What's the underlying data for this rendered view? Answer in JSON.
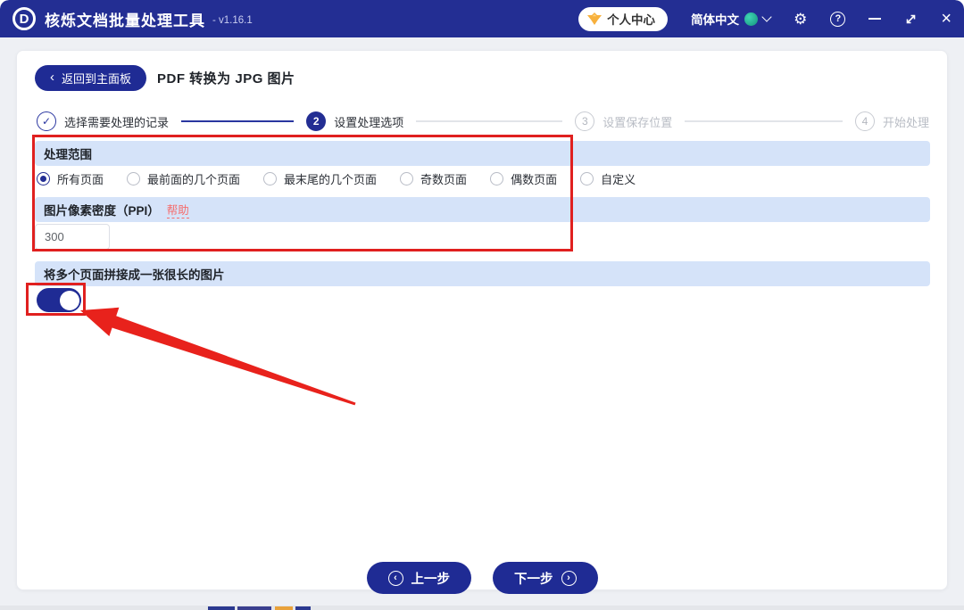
{
  "titlebar": {
    "logo_letter": "D",
    "app_title": "核烁文档批量处理工具",
    "version": "- v1.16.1",
    "personal_center_label": "个人中心",
    "language_label": "简体中文"
  },
  "icons": {
    "back_chevron": "‹",
    "prev_chevron": "‹",
    "next_chevron": "›",
    "check": "✓",
    "gear": "⚙",
    "help_mark": "?",
    "close": "×"
  },
  "page": {
    "back_button_label": "返回到主面板",
    "title": "PDF 转换为 JPG 图片"
  },
  "steps": [
    {
      "num": "1",
      "label": "选择需要处理的记录",
      "state": "done"
    },
    {
      "num": "2",
      "label": "设置处理选项",
      "state": "active"
    },
    {
      "num": "3",
      "label": "设置保存位置",
      "state": "pending"
    },
    {
      "num": "4",
      "label": "开始处理",
      "state": "pending"
    }
  ],
  "sections": {
    "range": {
      "title": "处理范围",
      "options": [
        {
          "label": "所有页面",
          "selected": true
        },
        {
          "label": "最前面的几个页面",
          "selected": false
        },
        {
          "label": "最末尾的几个页面",
          "selected": false
        },
        {
          "label": "奇数页面",
          "selected": false
        },
        {
          "label": "偶数页面",
          "selected": false
        },
        {
          "label": "自定义",
          "selected": false
        }
      ]
    },
    "ppi": {
      "title": "图片像素密度（PPI）",
      "help_label": "帮助",
      "value": "300"
    },
    "stitch": {
      "title": "将多个页面拼接成一张很长的图片",
      "toggle_on": true
    }
  },
  "footer": {
    "prev_label": "上一步",
    "next_label": "下一步"
  },
  "colors": {
    "titlebar_bg": "#232e93",
    "accent_blue": "#1f2b94",
    "section_bar_bg": "#d5e3f9",
    "annotation_red": "#e0201f",
    "help_link": "#f56c6c",
    "vip_gold": "#f7b03c",
    "globe_teal": "#23ab92"
  }
}
